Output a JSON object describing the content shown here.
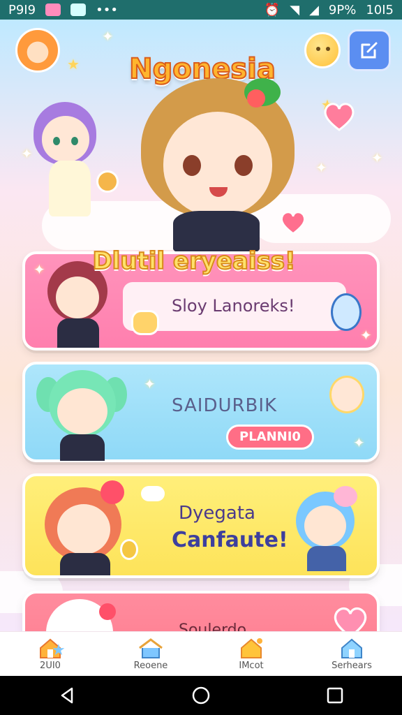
{
  "status_bar": {
    "left_text": "P9I9",
    "battery": "9P%",
    "time": "10I5"
  },
  "header": {
    "title": "Ngonesia"
  },
  "banner": {
    "text": "Dlutil eryeaiss!"
  },
  "cards": [
    {
      "id": "pink",
      "label": "Sloy Lanoreks!"
    },
    {
      "id": "blue",
      "label": "SAIDURBIK",
      "pill": "PLANNI0"
    },
    {
      "id": "yellow",
      "label_line1": "Dyegata",
      "label_line2": "Canfaute!"
    },
    {
      "id": "red",
      "label": "Soulerdo"
    }
  ],
  "bottom_nav": {
    "items": [
      {
        "label": "2UI0",
        "icon": "home-icon"
      },
      {
        "label": "Reoene",
        "icon": "house-icon"
      },
      {
        "label": "IMcot",
        "icon": "house-star-icon"
      },
      {
        "label": "Serhears",
        "icon": "home-outline-icon"
      }
    ]
  },
  "colors": {
    "status_bar": "#1f6e6c",
    "pink_card": "#ff8cb6",
    "blue_card": "#9fe0f9",
    "yellow_card": "#fde86a",
    "red_card": "#ff8596",
    "accent_blue": "#5b8ef1"
  }
}
